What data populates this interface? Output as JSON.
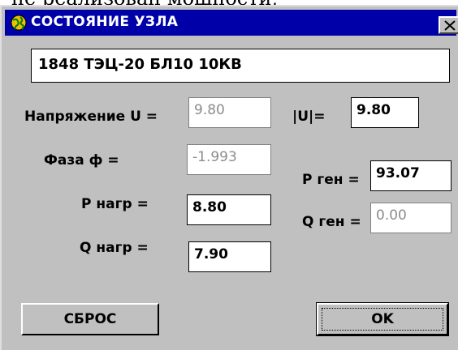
{
  "background_text": "не реализован мощности,",
  "dialog": {
    "title": "СОСТОЯНИЕ УЗЛА",
    "title_icon": "globe-icon",
    "close_icon": "close-icon",
    "node_name": "1848 ТЭЦ-20 БЛ10 10КВ"
  },
  "fields": {
    "voltage_label": "Напряжение U =",
    "voltage_value": "9.80",
    "abs_u_label": "|U|=",
    "abs_u_value": "9.80",
    "phase_label": "Фаза  ф  =",
    "phase_value": "-1.993",
    "p_gen_label": "Р ген =",
    "p_gen_value": "93.07",
    "p_load_label": "Р нагр =",
    "p_load_value": "8.80",
    "q_gen_label": "Q ген =",
    "q_gen_value": "0.00",
    "q_load_label": "Q нагр =",
    "q_load_value": "7.90"
  },
  "buttons": {
    "reset_label": "СБРОС",
    "ok_label": "OK"
  },
  "colors": {
    "titlebar": "#0000a8",
    "dialog_bg": "#c0c0c0",
    "disabled_text": "#8c8c8c"
  }
}
